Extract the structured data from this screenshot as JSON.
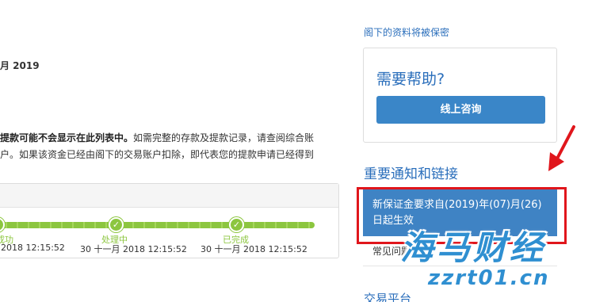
{
  "main": {
    "date_heading": "月 2019",
    "notice": {
      "bold_text": "提款可能不会显示在此列表中。",
      "text_line1": "如需完整的存款及提款记录，请查阅综合账",
      "text_line2": "户。如果该资金已经由阁下的交易账户扣除，即代表您的提款申请已经得到"
    },
    "tracker": {
      "steps": [
        {
          "status": "成功",
          "time": "2018 12:15:52"
        },
        {
          "status": "处理中",
          "time": "30 十一月 2018 12:15:52"
        },
        {
          "status": "已完成",
          "time": "30 十一月 2018 12:15:52"
        }
      ]
    }
  },
  "sidebar": {
    "privacy_link": "阁下的资料将被保密",
    "help": {
      "title": "需要帮助?",
      "button_label": "线上咨询"
    },
    "notices_title": "重要通知和链接",
    "links": {
      "active_line1": "新保证金要求自(2019)年(07)月(26)",
      "active_line2": "日起生效",
      "faq": "常见问题",
      "partial": "交易平台"
    }
  },
  "watermark": {
    "main": "海马财经",
    "sub": "zzrt01.cn"
  },
  "colors": {
    "accent": "#2a6ebb",
    "button": "#3a86c8",
    "progress": "#8cc63f",
    "highlight": "#e0161c"
  },
  "icons": [
    "check-icon",
    "red-arrow-annotation"
  ]
}
